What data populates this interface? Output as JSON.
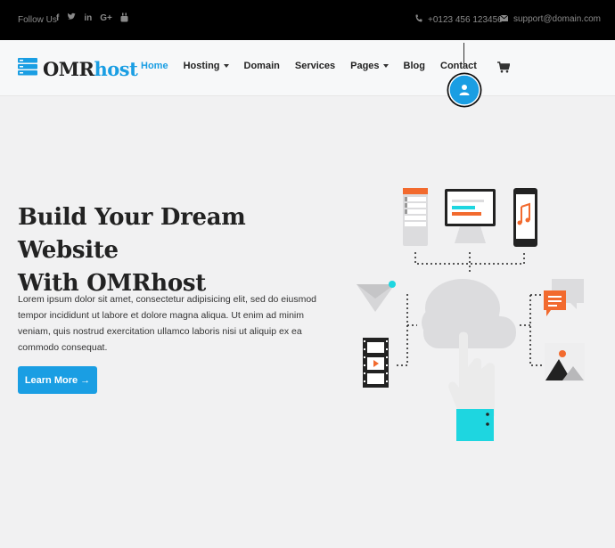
{
  "topbar": {
    "follow_label": "Follow Us",
    "social_icons": [
      "facebook-icon",
      "twitter-icon",
      "linkedin-icon",
      "google-plus-icon",
      "youtube-icon"
    ],
    "phone": "+0123 456 123456",
    "email": "support@domain.com"
  },
  "brand": {
    "name_part1": "OMR",
    "name_part2": "host"
  },
  "nav": {
    "items": [
      {
        "label": "Home",
        "active": true
      },
      {
        "label": "Hosting"
      },
      {
        "label": "Domain"
      },
      {
        "label": "Services"
      },
      {
        "label": "Pages"
      },
      {
        "label": "Blog"
      },
      {
        "label": "Contact"
      }
    ]
  },
  "hero": {
    "title_line1": "Build Your Dream Website",
    "title_line2": "With OMRhost",
    "text": "Lorem ipsum dolor sit amet, consectetur adipisicing elit, sed do eiusmod tempor incididunt ut labore et dolore magna aliqua. Ut enim ad minim veniam, quis nostrud exercitation ullamco laboris nisi ut aliquip ex ea commodo consequat.",
    "button_label": "Learn More →"
  },
  "colors": {
    "accent": "#1a9ee3",
    "dark": "#222222",
    "orange": "#f26a2e",
    "teal": "#1ed6e0"
  }
}
